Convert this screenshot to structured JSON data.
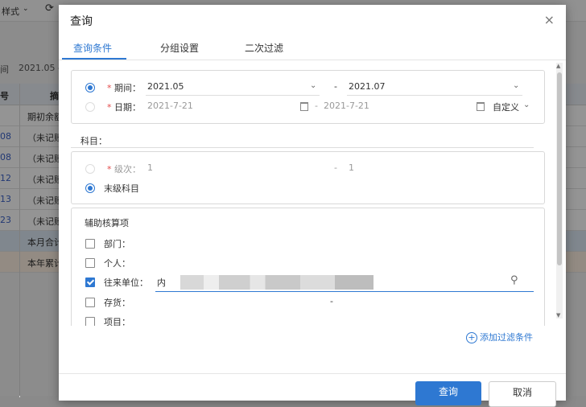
{
  "background": {
    "toolbar_item": "样式",
    "period_label": "间",
    "period_value": "2021.05 -",
    "header_col1": "号",
    "header_col2": "摘",
    "rows": [
      {
        "n": "",
        "d": "期初余额"
      },
      {
        "n": "08",
        "d": "（未记账"
      },
      {
        "n": "08",
        "d": "（未记账"
      },
      {
        "n": "12",
        "d": "（未记账"
      },
      {
        "n": "13",
        "d": "（未记账"
      },
      {
        "n": "23",
        "d": "（未记账"
      },
      {
        "n": "",
        "d": "本月合计"
      },
      {
        "n": "",
        "d": "本年累计"
      }
    ]
  },
  "dialog": {
    "title": "查询",
    "close": "×",
    "tabs": [
      "查询条件",
      "分组设置",
      "二次过滤"
    ],
    "period": {
      "required_mark": "*",
      "label": "期间：",
      "start": "2021.05",
      "dash": "-",
      "end": "2021.07"
    },
    "date": {
      "required_mark": "*",
      "label": "日期：",
      "start": "2021-7-21",
      "dash": "-",
      "end": "2021-7-21",
      "custom": "自定义"
    },
    "subject_label": "科目：",
    "level": {
      "required_mark": "*",
      "label": "级次：",
      "start": "1",
      "dash": "-",
      "end": "1"
    },
    "leaf_subject": "末级科目",
    "aux": {
      "title": "辅助核算项",
      "items": [
        {
          "label": "部门：",
          "checked": false,
          "value": ""
        },
        {
          "label": "个人：",
          "checked": false,
          "value": ""
        },
        {
          "label": "往来单位：",
          "checked": true,
          "value": "内"
        },
        {
          "label": "存货：",
          "checked": false,
          "value": "-"
        },
        {
          "label": "项目：",
          "checked": false,
          "value": ""
        }
      ]
    },
    "add_filter": "添加过滤条件",
    "buttons": {
      "query": "查询",
      "cancel": "取消"
    }
  }
}
